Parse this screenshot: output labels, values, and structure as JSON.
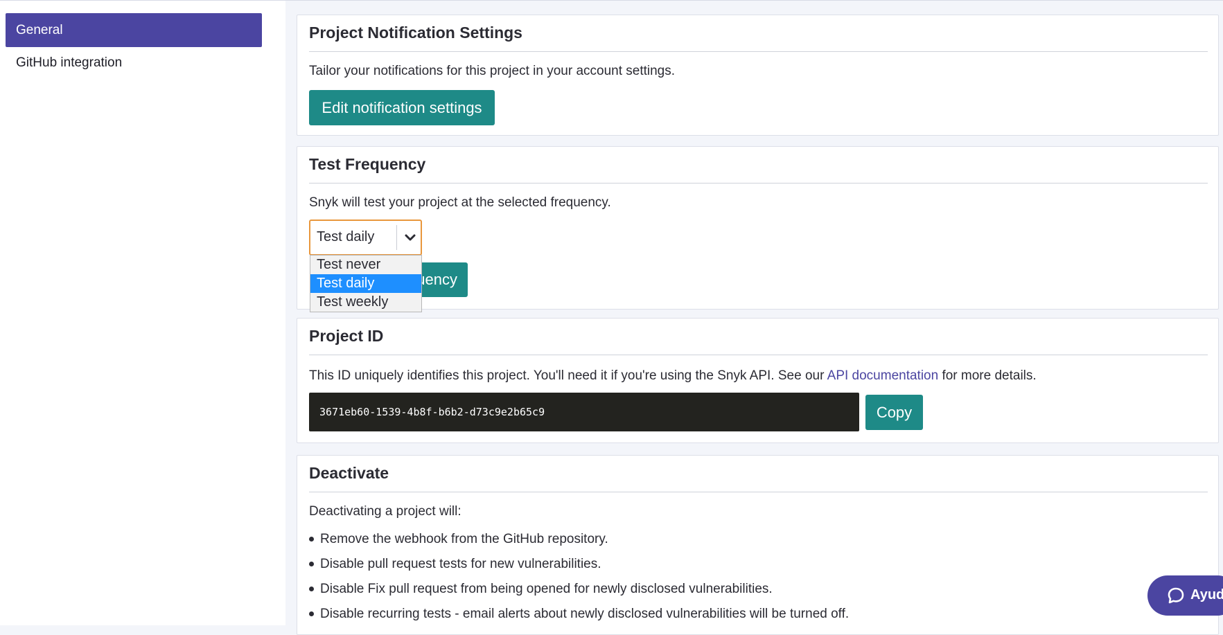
{
  "sidebar": {
    "items": [
      {
        "label": "General",
        "active": true
      },
      {
        "label": "GitHub integration",
        "active": false
      }
    ]
  },
  "notifications": {
    "title": "Project Notification Settings",
    "description": "Tailor your notifications for this project in your account settings.",
    "button_label": "Edit notification settings"
  },
  "frequency": {
    "title": "Test Frequency",
    "description": "Snyk will test your project at the selected frequency.",
    "selected": "Test daily",
    "options": [
      "Test never",
      "Test daily",
      "Test weekly"
    ],
    "button_label_visible": "quency"
  },
  "project_id": {
    "title": "Project ID",
    "description_before": "This ID uniquely identifies this project. You'll need it if you're using the Snyk API. See our ",
    "link_text": "API documentation",
    "description_after": " for more details.",
    "id_value": "3671eb60-1539-4b8f-b6b2-d73c9e2b65c9",
    "copy_label": "Copy"
  },
  "deactivate": {
    "title": "Deactivate",
    "intro": "Deactivating a project will:",
    "bullets": [
      "Remove the webhook from the GitHub repository.",
      "Disable pull request tests for new vulnerabilities.",
      "Disable Fix pull request from being opened for newly disclosed vulnerabilities.",
      "Disable recurring tests - email alerts about newly disclosed vulnerabilities will be turned off."
    ]
  },
  "help": {
    "label": "Ayud",
    "icon": "chat-bubble-icon"
  },
  "colors": {
    "accent": "#4b45a1",
    "teal": "#1e8a87",
    "focus": "#e9973c",
    "selected_option": "#1e8fff"
  }
}
